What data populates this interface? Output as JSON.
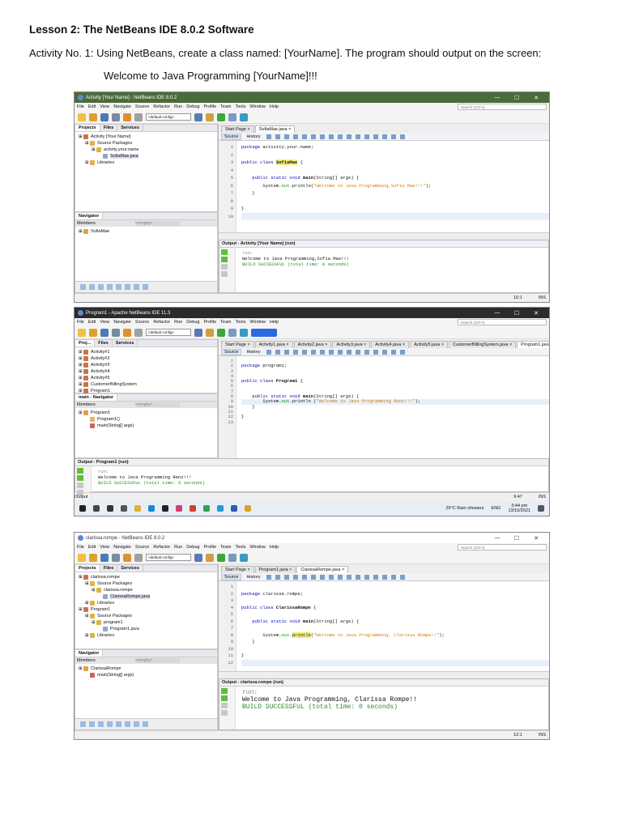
{
  "doc": {
    "heading": "Lesson 2: The NetBeans IDE 8.0.2 Software",
    "activity": "Activity No. 1: Using NetBeans, create a class named: [YourName]. The program should output on the screen:",
    "expected": "Welcome to Java Programming [YourName]!!!"
  },
  "windows": [
    {
      "title": "Activity [Your Name] - NetBeans IDE 8.0.2",
      "titlebar_color": "#4a6b3a",
      "title_text_color": "#ffffff",
      "menu": [
        "File",
        "Edit",
        "View",
        "Navigate",
        "Source",
        "Refactor",
        "Run",
        "Debug",
        "Profile",
        "Team",
        "Tools",
        "Window",
        "Help"
      ],
      "config": "<default config>",
      "search": "Search (Ctrl+I)",
      "project_tabs": [
        "Projects",
        "Files",
        "Services"
      ],
      "tree": [
        {
          "d": 0,
          "t": "Activity [Your Name]",
          "i": "project"
        },
        {
          "d": 1,
          "t": "Source Packages",
          "i": "folder"
        },
        {
          "d": 2,
          "t": "activity.your.name",
          "i": "package"
        },
        {
          "d": 3,
          "t": "SofiaMae.java",
          "i": "file",
          "sel": true
        },
        {
          "d": 1,
          "t": "Libraries",
          "i": "folder"
        }
      ],
      "editor_tabs": [
        "Start Page",
        "SofiaMae.java"
      ],
      "active_tab": 1,
      "source_tabs": [
        "Source",
        "History"
      ],
      "code": [
        [
          [
            "package ",
            "kw"
          ],
          [
            "activity.your.name;",
            ""
          ]
        ],
        [],
        [
          [
            "public class ",
            "kw"
          ],
          [
            "SofiaMae",
            "cls hl"
          ],
          [
            " {",
            ""
          ]
        ],
        [],
        [
          [
            "    public static void ",
            "kw"
          ],
          [
            "main",
            "cls"
          ],
          [
            "(String[] args) {",
            ""
          ]
        ],
        [
          [
            "        System.",
            ""
          ],
          [
            "out",
            "fld"
          ],
          [
            ".println(",
            ""
          ],
          [
            "\"Welcome to Java Programming,Sofia Mae!!!\"",
            "str"
          ],
          [
            ");",
            ""
          ]
        ],
        [
          [
            "    }",
            ""
          ]
        ],
        [],
        [
          [
            "}",
            ""
          ]
        ],
        []
      ],
      "current_line": 10,
      "navigator": {
        "title": "Navigator",
        "members": "Members",
        "filter": "<empty>",
        "tree": [
          {
            "d": 0,
            "t": "SofiaMae",
            "i": "class"
          }
        ]
      },
      "output": {
        "title": "Output - Activity [Your Name] (run)",
        "lines": [
          "run:",
          "Welcome to Java Programming,Sofia Mae!!!",
          "BUILD SUCCESSFUL (total time: 0 seconds)"
        ]
      },
      "status": [
        "10:1",
        "INS"
      ]
    },
    {
      "title": "Program1 - Apache NetBeans IDE 11.3",
      "titlebar_color": "#2b2b2b",
      "title_text_color": "#ffffff",
      "menu": [
        "File",
        "Edit",
        "View",
        "Navigate",
        "Source",
        "Refactor",
        "Run",
        "Debug",
        "Profile",
        "Team",
        "Tools",
        "Window",
        "Help"
      ],
      "config": "<default config>",
      "search": "Search (Ctrl+I)",
      "project_tabs": [
        "Proj...",
        "Files",
        "Services"
      ],
      "tree": [
        {
          "d": 0,
          "t": "Activity#1",
          "i": "project"
        },
        {
          "d": 0,
          "t": "Activity#2",
          "i": "project"
        },
        {
          "d": 0,
          "t": "Activity#3",
          "i": "project"
        },
        {
          "d": 0,
          "t": "Activity#4",
          "i": "project"
        },
        {
          "d": 0,
          "t": "Activity#5",
          "i": "project"
        },
        {
          "d": 0,
          "t": "CustomerBillingSystem",
          "i": "project"
        },
        {
          "d": 0,
          "t": "Program1",
          "i": "project"
        },
        {
          "d": 1,
          "t": "Source Packages",
          "i": "folder"
        },
        {
          "d": 2,
          "t": "program1",
          "i": "package"
        },
        {
          "d": 3,
          "t": "Program1.java",
          "i": "file",
          "sel": true
        },
        {
          "d": 1,
          "t": "Libraries",
          "i": "folder"
        }
      ],
      "editor_tabs": [
        "Start Page",
        "Activity1.java",
        "Activity2.java",
        "Activity3.java",
        "Activity4.java",
        "Activity5.java",
        "CustomerBillingSystem.java",
        "Program1.java"
      ],
      "active_tab": 7,
      "source_tabs": [
        "Source",
        "History"
      ],
      "code": [
        [],
        [
          [
            "package ",
            "kw"
          ],
          [
            "program1;",
            ""
          ]
        ],
        [],
        [],
        [
          [
            "public class ",
            "kw"
          ],
          [
            "Program1",
            "cls"
          ],
          [
            " {",
            ""
          ]
        ],
        [],
        [],
        [
          [
            "    public static void ",
            "kw"
          ],
          [
            "main",
            "cls"
          ],
          [
            "(String[] args) {",
            ""
          ]
        ],
        [
          [
            "        System.",
            ""
          ],
          [
            "out",
            "fld"
          ],
          [
            ".println (",
            ""
          ],
          [
            "\"Welcome to Java Programming Renz!!!\"",
            "str"
          ],
          [
            ");",
            ""
          ]
        ],
        [
          [
            "    }",
            ""
          ]
        ],
        [],
        [
          [
            "}",
            ""
          ]
        ],
        []
      ],
      "current_line": 9,
      "navigator": {
        "title": "main - Navigator",
        "members": "Members",
        "filter": "<empty>",
        "tree": [
          {
            "d": 0,
            "t": "Program1",
            "i": "class"
          },
          {
            "d": 1,
            "t": "Program1()",
            "i": "ctor"
          },
          {
            "d": 1,
            "t": "main(String[] args)",
            "i": "method"
          }
        ]
      },
      "output": {
        "title": "Output - Program1 (run)",
        "lines": [
          "run:",
          "Welcome to Java Programming Renz!!!",
          "BUILD SUCCESSFUL (total time: 5 seconds)"
        ]
      },
      "output_tab": "Output",
      "status": [
        "9:47",
        "INS"
      ],
      "taskbar": {
        "weather": "26°C  Rain showers",
        "lang": "ENG",
        "time": "3:44 pm",
        "date": "13/10/2021"
      }
    },
    {
      "title": "clarissa.rompe - NetBeans IDE 8.0.2",
      "titlebar_color": "#ffffff",
      "title_text_color": "#333333",
      "menu": [
        "File",
        "Edit",
        "View",
        "Navigate",
        "Source",
        "Refactor",
        "Run",
        "Debug",
        "Profile",
        "Team",
        "Tools",
        "Window",
        "Help"
      ],
      "config": "<default config>",
      "search": "Search (Ctrl+I)",
      "project_tabs": [
        "Projects",
        "Files",
        "Services"
      ],
      "tree": [
        {
          "d": 0,
          "t": "clarissa.rompe",
          "i": "project"
        },
        {
          "d": 1,
          "t": "Source Packages",
          "i": "folder"
        },
        {
          "d": 2,
          "t": "clarissa.rompe",
          "i": "package"
        },
        {
          "d": 3,
          "t": "ClarissaRompe.java",
          "i": "file",
          "sel": true
        },
        {
          "d": 1,
          "t": "Libraries",
          "i": "folder"
        },
        {
          "d": 0,
          "t": "Program1",
          "i": "project"
        },
        {
          "d": 1,
          "t": "Source Packages",
          "i": "folder"
        },
        {
          "d": 2,
          "t": "program1",
          "i": "package"
        },
        {
          "d": 3,
          "t": "Program1.java",
          "i": "file"
        },
        {
          "d": 1,
          "t": "Libraries",
          "i": "folder"
        }
      ],
      "editor_tabs": [
        "Start Page",
        "Program1.java",
        "ClarissaRompe.java"
      ],
      "active_tab": 2,
      "source_tabs": [
        "Source",
        "History"
      ],
      "code": [
        [],
        [
          [
            "package ",
            "kw"
          ],
          [
            "clarissa.rompe;",
            ""
          ]
        ],
        [],
        [
          [
            "public class ",
            "kw"
          ],
          [
            "ClarissaRompe",
            "cls"
          ],
          [
            " {",
            ""
          ]
        ],
        [],
        [
          [
            "    public static void ",
            "kw"
          ],
          [
            "main",
            "cls"
          ],
          [
            "(String[] args) {",
            ""
          ]
        ],
        [],
        [
          [
            "        System.",
            ""
          ],
          [
            "out",
            "fld"
          ],
          [
            ".",
            ""
          ],
          [
            "println",
            "hl"
          ],
          [
            "(",
            ""
          ],
          [
            "\"Welcome to Java Programming, Clarissa Rompe!!\"",
            "str"
          ],
          [
            ");",
            ""
          ]
        ],
        [
          [
            "    }",
            ""
          ]
        ],
        [],
        [
          [
            "}",
            ""
          ]
        ],
        []
      ],
      "current_line": 12,
      "navigator": {
        "title": "Navigator",
        "members": "Members",
        "filter": "<empty>",
        "tree": [
          {
            "d": 0,
            "t": "ClarissaRompe",
            "i": "class"
          },
          {
            "d": 1,
            "t": "main(String[] args)",
            "i": "method"
          }
        ]
      },
      "output": {
        "title": "Output - clarissa.rompe (run)",
        "lines": [
          "run:",
          "Welcome to Java Programming, Clarissa Rompe!!",
          "BUILD SUCCESSFUL (total time: 0 seconds)"
        ]
      },
      "status": [
        "12:1",
        "INS"
      ]
    }
  ]
}
